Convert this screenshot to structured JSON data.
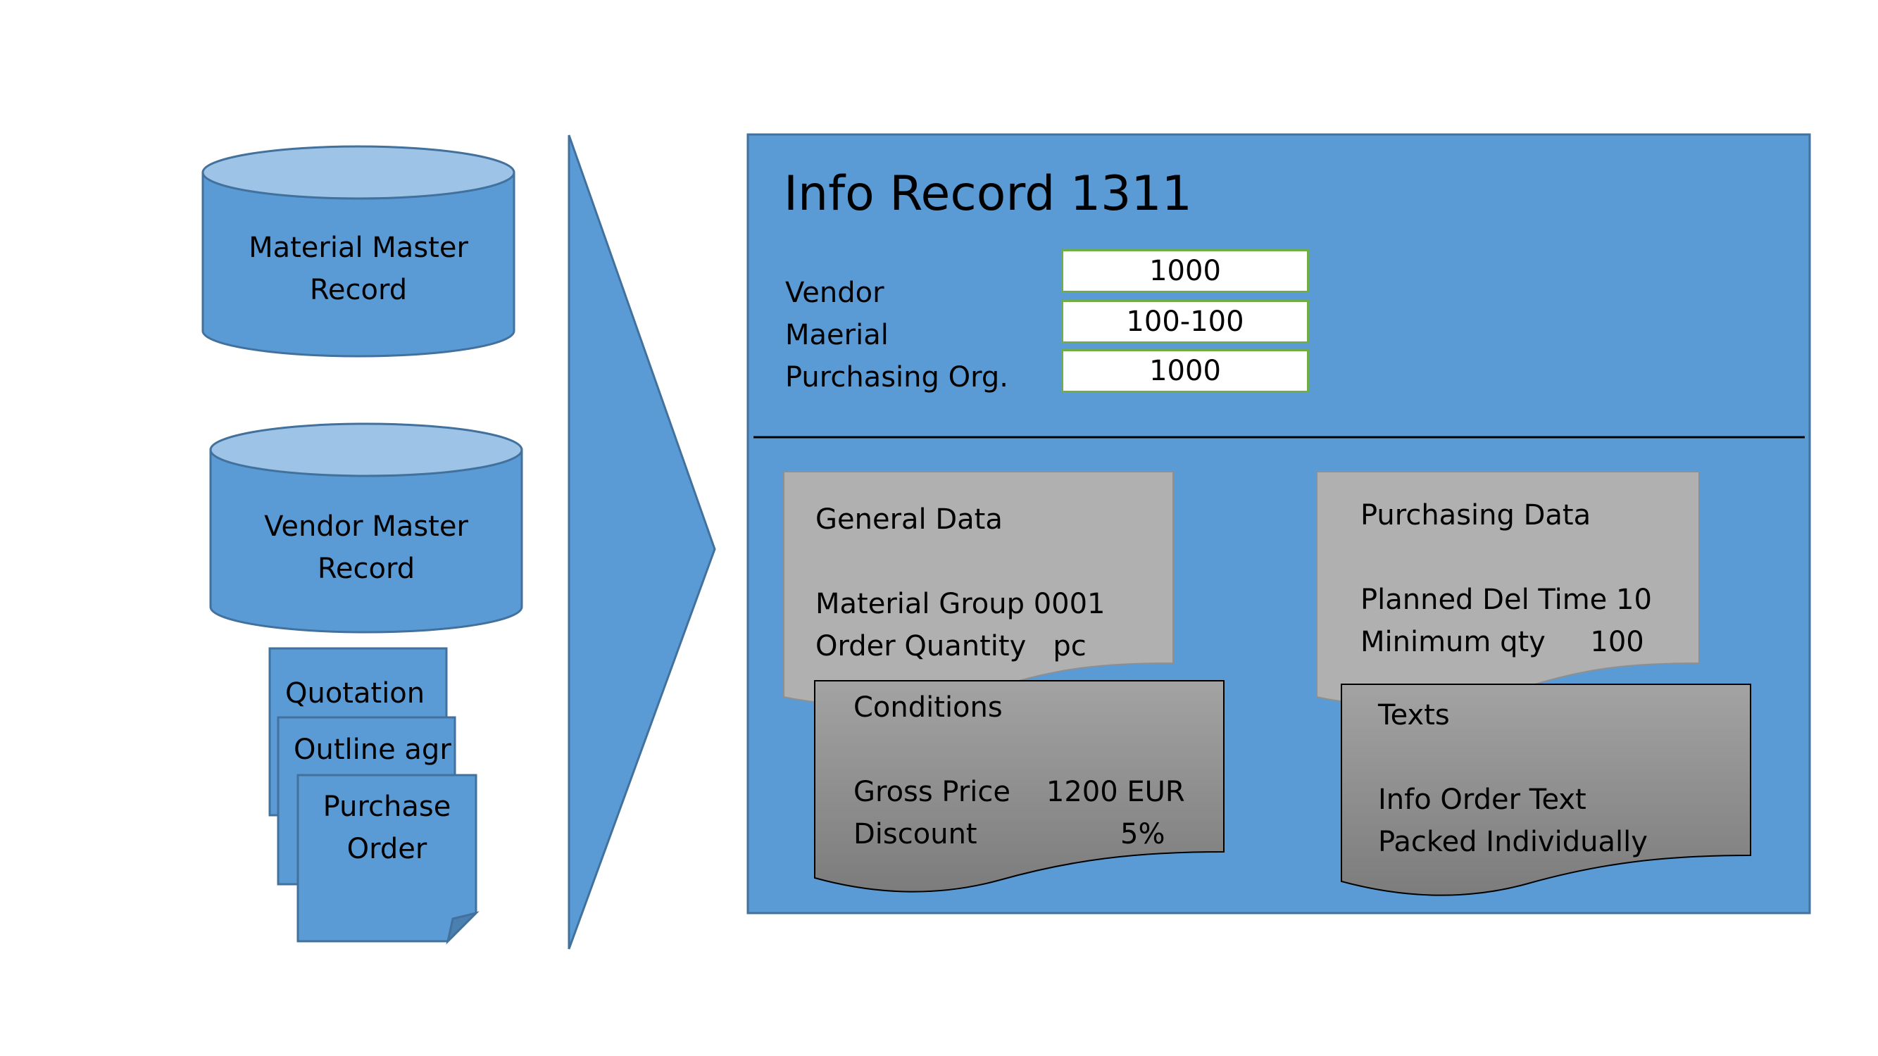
{
  "colors": {
    "shape_fill": "#5b9bd5",
    "shape_top": "#9dc3e6",
    "shape_stroke": "#41719c",
    "doc_light": "#b0b0b0",
    "doc_dark_top": "#a0a0a0",
    "doc_dark_bottom": "#7f7f7f",
    "field_border": "#70ad47"
  },
  "sources": {
    "material_master": [
      "Material Master",
      "Record"
    ],
    "vendor_master": [
      "Vendor Master",
      "Record"
    ],
    "documents": {
      "quotation": "Quotation",
      "outline_agreement": "Outline agr",
      "purchase_order": [
        "Purchase",
        "Order"
      ]
    }
  },
  "info_record": {
    "title": "Info Record 1311",
    "fields": [
      {
        "label": "Vendor",
        "value": "1000"
      },
      {
        "label": "Maerial",
        "value": "100-100"
      },
      {
        "label": "Purchasing Org.",
        "value": "1000"
      }
    ],
    "general_data": {
      "heading": "General Data",
      "lines": [
        "Material Group 0001",
        "Order Quantity   pc"
      ]
    },
    "conditions": {
      "heading": "Conditions",
      "lines": [
        "Gross Price    1200 EUR",
        "Discount                5%"
      ]
    },
    "purchasing_data": {
      "heading": "Purchasing Data",
      "lines": [
        "Planned Del Time 10",
        "Minimum qty     100"
      ]
    },
    "texts": {
      "heading": "Texts",
      "lines": [
        "Info Order Text",
        "Packed Individually"
      ]
    }
  }
}
